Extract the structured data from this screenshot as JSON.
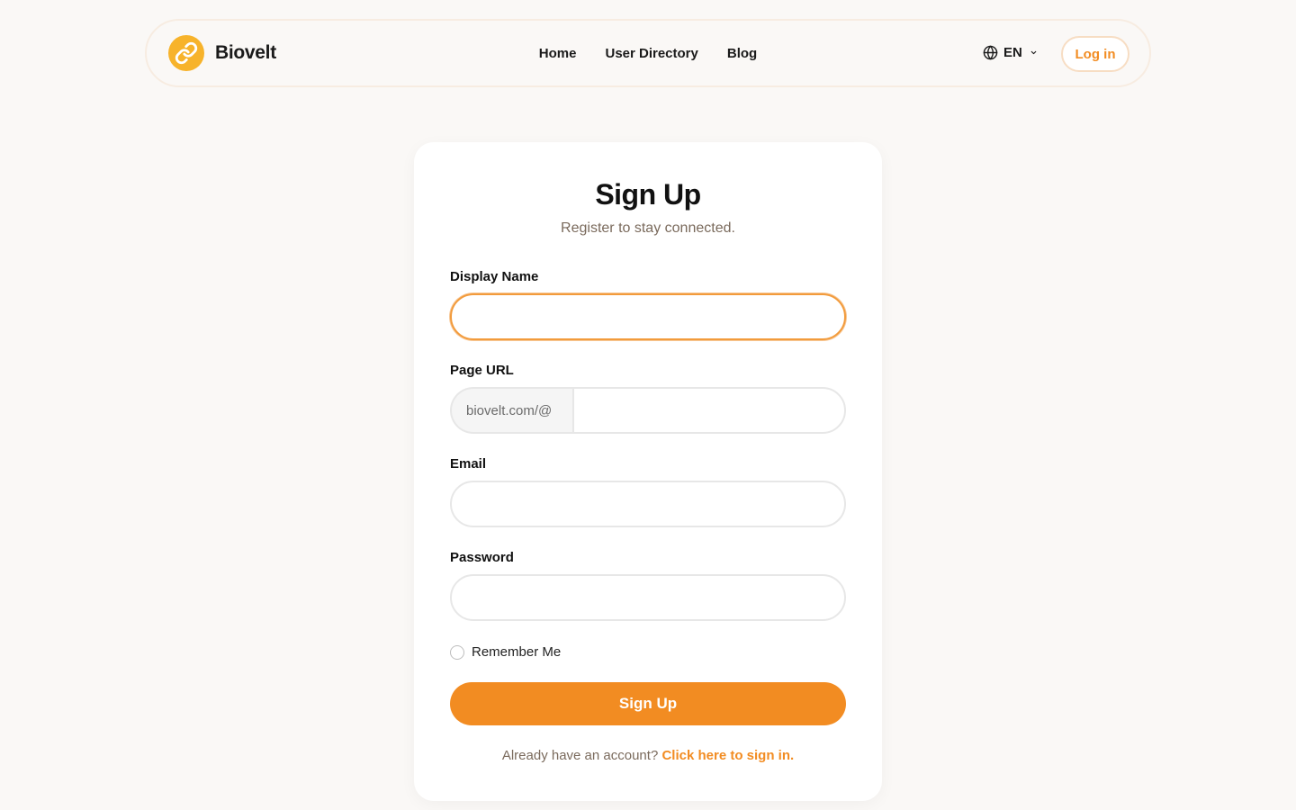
{
  "brand": {
    "name": "Biovelt",
    "icon": "link-icon",
    "accent": "#f28c22",
    "logo_color": "#f7b32b"
  },
  "nav": {
    "links": [
      {
        "label": "Home"
      },
      {
        "label": "User Directory"
      },
      {
        "label": "Blog"
      }
    ],
    "language": {
      "icon": "globe-icon",
      "code": "EN"
    },
    "login_label": "Log in"
  },
  "form": {
    "title": "Sign Up",
    "subtitle": "Register to stay connected.",
    "display_name": {
      "label": "Display Name",
      "value": "",
      "placeholder": ""
    },
    "page_url": {
      "label": "Page URL",
      "prefix": "biovelt.com/@",
      "value": "",
      "placeholder": ""
    },
    "email": {
      "label": "Email",
      "value": "",
      "placeholder": ""
    },
    "password": {
      "label": "Password",
      "value": "",
      "placeholder": ""
    },
    "remember_me": {
      "label": "Remember Me",
      "checked": false
    },
    "submit_label": "Sign Up",
    "signin_prompt": "Already have an account?",
    "signin_link": "Click here to sign in."
  }
}
